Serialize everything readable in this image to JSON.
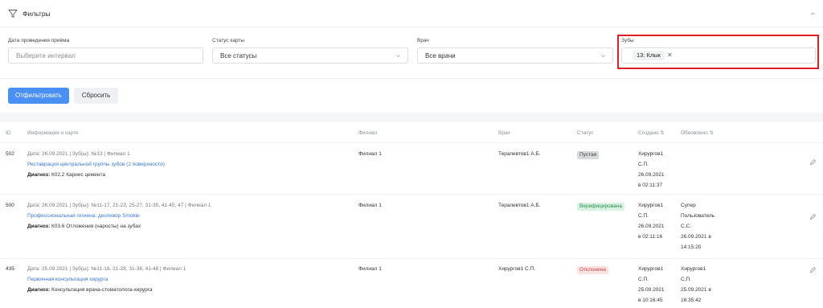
{
  "panel": {
    "title": "Фильтры"
  },
  "filters": {
    "date": {
      "label": "Дата проведения приёма",
      "placeholder": "Выберите интервал"
    },
    "status": {
      "label": "Статус карты",
      "value": "Все статусы"
    },
    "doctor": {
      "label": "Врач",
      "value": "Все врачи"
    },
    "teeth": {
      "label": "Зубы",
      "tag": "13: Клык"
    }
  },
  "buttons": {
    "filter": "Отфильтровать",
    "reset": "Сбросить"
  },
  "table": {
    "headers": {
      "id": "ID",
      "info": "Информация о карте",
      "branch": "Филиал",
      "doctor": "Врач",
      "status": "Статус",
      "created": "Создано",
      "updated": "Обновлено"
    },
    "rows": [
      {
        "id": "502",
        "meta": "Дата: 26.09.2021 | Зуб(ы): №13 | Филиал 1",
        "link": "Реставрация центральной группы зубов (2 поверхности)",
        "diag_label": "Диагноз:",
        "diag_text": "К02.2 Кариес цемента",
        "branch": "Филиал 1",
        "doctor": "Терапевтов1 А.Б.",
        "status": "Пустая",
        "created": [
          "Хирургов1",
          "С.П.",
          "26.09.2021",
          "в 02:11:37"
        ],
        "updated": []
      },
      {
        "id": "500",
        "meta": "Дата: 26.09.2021 | Зуб(ы): №11-17, 21-23, 25-27, 31-35, 41-45, 47 | Филиал 1",
        "link": "Профессиональная гигиена: дентивор Smokie",
        "diag_label": "Диагноз:",
        "diag_text": "К03.6 Отложения (наросты) на зубах",
        "branch": "Филиал 1",
        "doctor": "Терапевтов1 А.Б.",
        "status": "Верифицирована",
        "created": [
          "Хирургов1",
          "С.П.",
          "26.09.2021",
          "в 02:11:16"
        ],
        "updated": [
          "Супер",
          "Пользователь",
          "С.С.",
          "26.09.2021 в",
          "14:15:20"
        ]
      },
      {
        "id": "435",
        "meta": "Дата: 25.09.2021 | Зуб(ы): №11-18, 21-28, 31-38, 41-48 | Филиал 1",
        "link": "Первичная консультация хирурга",
        "diag_label": "Диагноз:",
        "diag_text": "Консультация врача-стоматолога-хирурга",
        "branch": "Филиал 1",
        "doctor": "Хирургов1 С.П.",
        "status": "Отклонена",
        "created": [
          "Хирургов1",
          "С.П.",
          "25.09.2021",
          "в 10:16:45"
        ],
        "updated": [
          "Хирургов1",
          "С.П.",
          "25.09.2021 в",
          "16:35:42"
        ]
      }
    ]
  },
  "colors": {
    "primary": "#4a8ff4",
    "highlight": "#e01e26",
    "link": "#3a78d8"
  }
}
